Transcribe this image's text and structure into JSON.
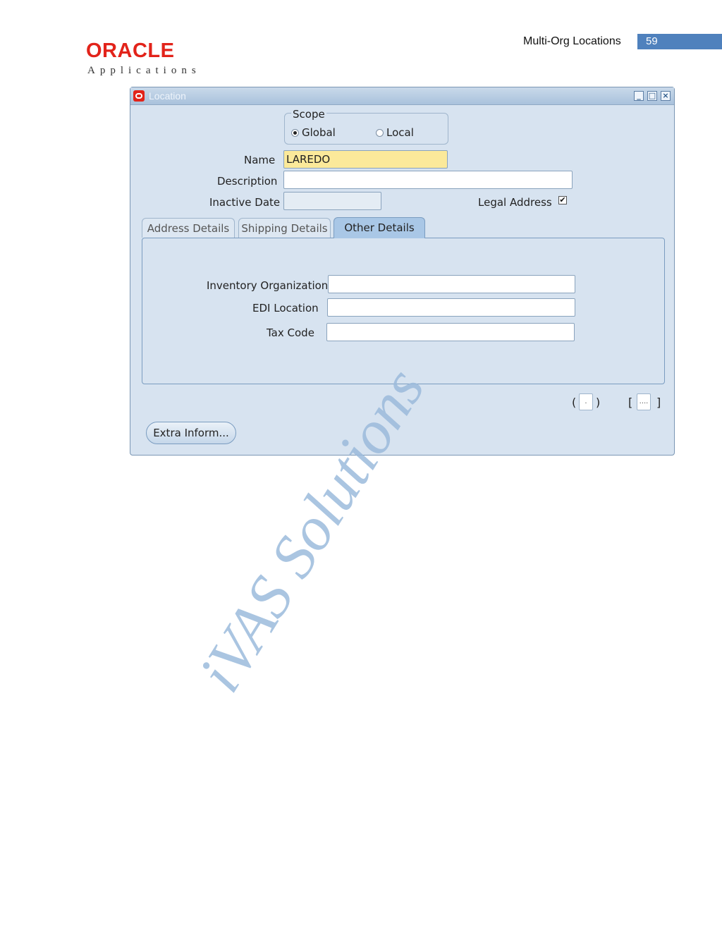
{
  "page_header": {
    "title": "Multi-Org Locations",
    "page_number": "59",
    "logo_word": "ORACLE",
    "logo_sub": "Applications"
  },
  "watermark": "iVAS Solutions",
  "window": {
    "title": "Location",
    "controls": [
      "minimize",
      "maximize",
      "close"
    ]
  },
  "scope": {
    "legend": "Scope",
    "options": [
      {
        "label": "Global",
        "selected": true
      },
      {
        "label": "Local",
        "selected": false
      }
    ]
  },
  "form": {
    "name_label": "Name",
    "name_value": "LAREDO",
    "description_label": "Description",
    "description_value": "",
    "inactive_date_label": "Inactive Date",
    "inactive_date_value": "",
    "legal_address_label": "Legal Address",
    "legal_address_checked": true
  },
  "tabs": [
    {
      "label": "Address Details",
      "active": false
    },
    {
      "label": "Shipping Details",
      "active": false
    },
    {
      "label": "Other Details",
      "active": true
    }
  ],
  "other_details": {
    "inventory_org_label": "Inventory Organization",
    "inventory_org_value": "",
    "edi_location_label": "EDI Location",
    "edi_location_value": "",
    "tax_code_label": "Tax Code",
    "tax_code_value": ""
  },
  "footer": {
    "paren_field": ".",
    "bracket_field": "....",
    "extra_button": "Extra Inform..."
  },
  "colors": {
    "accent_blue": "#4f81bd",
    "oracle_red": "#e2231a",
    "required_field": "#fbe99a",
    "window_bg": "#d7e3f0"
  }
}
